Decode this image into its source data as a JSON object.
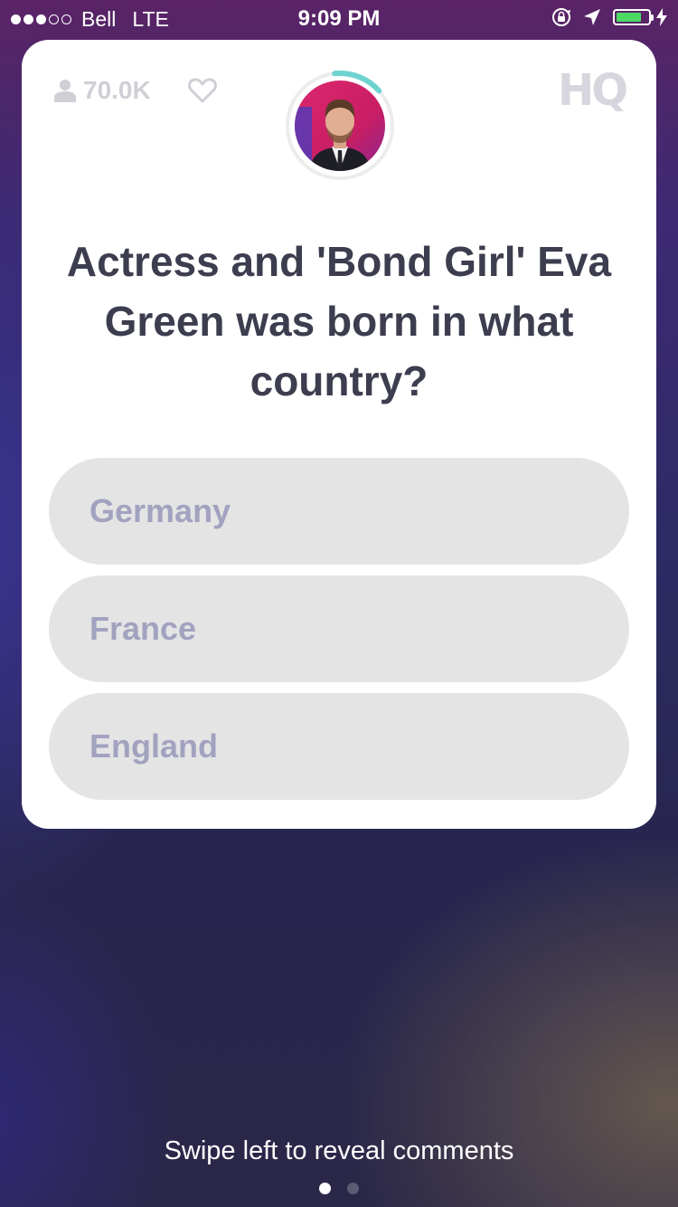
{
  "status_bar": {
    "carrier": "Bell",
    "network": "LTE",
    "time": "9:09 PM",
    "signal_bars_filled": 3,
    "signal_bars_total": 5,
    "battery_level": 0.8
  },
  "header": {
    "viewer_count": "70.0K",
    "logo": "HQ",
    "timer_fraction": 0.15
  },
  "question": {
    "text": "Actress and 'Bond Girl' Eva Green was born in what country?"
  },
  "answers": [
    {
      "label": "Germany"
    },
    {
      "label": "France"
    },
    {
      "label": "England"
    }
  ],
  "footer": {
    "hint": "Swipe left to reveal comments",
    "page_count": 2,
    "active_page": 1
  },
  "colors": {
    "card": "#ffffff",
    "answer_bg": "#e4e4e4",
    "answer_text": "#a2a2c0",
    "question_text": "#3c3d4e",
    "timer_accent": "#6ed3d0",
    "battery": "#4cd964"
  },
  "icons": {
    "viewers": "user-icon",
    "like": "heart-icon",
    "orientation_lock": "rotation-lock-icon",
    "location": "location-arrow-icon",
    "charging": "lightning-bolt-icon"
  }
}
